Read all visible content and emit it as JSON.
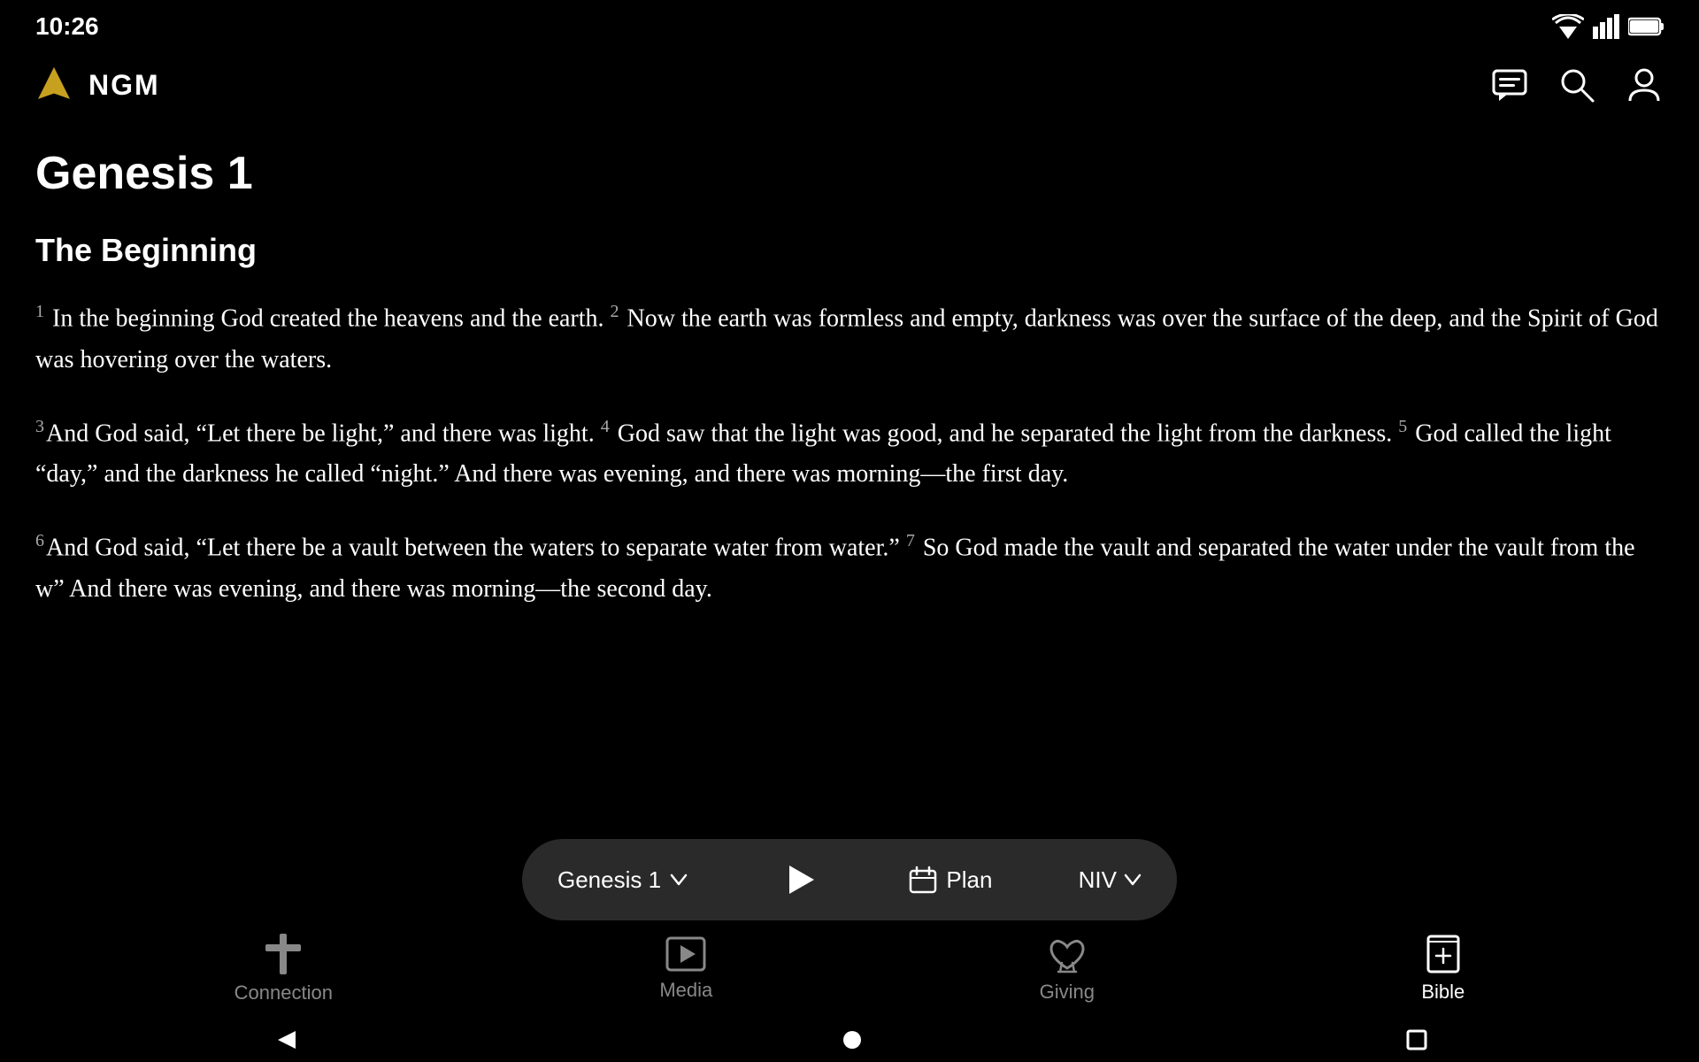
{
  "status": {
    "time": "10:26"
  },
  "header": {
    "brand": "NGM"
  },
  "chapter": {
    "title": "Genesis 1",
    "section": "The Beginning"
  },
  "verses": [
    {
      "id": "v1-2",
      "num1": "1",
      "text1": "In the beginning God created the heavens and the earth.",
      "num2": "2",
      "text2": "Now the earth was formless and empty, darkness was over the surface of the deep, and the Spirit of God was hovering over the waters."
    },
    {
      "id": "v3-5",
      "num3": "3",
      "text3": "And God said, “Let there be light,” and there was light.",
      "num4": "4",
      "text4": "God saw that the light was good, and he separated the light from the darkness.",
      "num5": "5",
      "text5": "God called the light “day,” and the darkness he called “night.” And there was evening, and there was morning—the first day."
    },
    {
      "id": "v6-7",
      "num6": "6",
      "text6": "And God said, “Let there be a vault between the waters to separate water from water.”",
      "num7": "7",
      "text7": "So God made the vault and separated the water under the vault from the w",
      "text7b": "” And there was evening, and there was morning—the second day."
    }
  ],
  "mediaBar": {
    "chapter": "Genesis 1",
    "chevron": "∨",
    "plan": "Plan",
    "version": "NIV"
  },
  "bottomNav": {
    "items": [
      {
        "label": "Connection",
        "icon": "cross"
      },
      {
        "label": "Media",
        "icon": "media"
      },
      {
        "label": "Giving",
        "icon": "giving"
      },
      {
        "label": "Bible",
        "icon": "bible",
        "active": true
      }
    ]
  },
  "androidNav": {
    "back": "◄",
    "home": "●",
    "recent": "■"
  }
}
